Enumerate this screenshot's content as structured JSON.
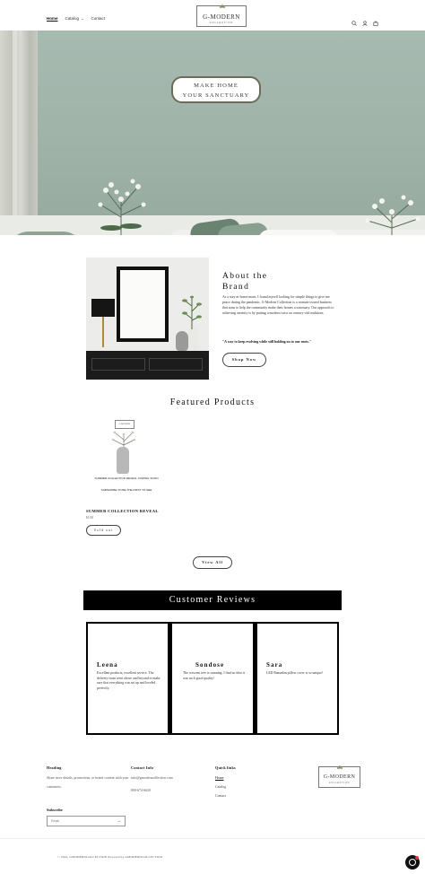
{
  "header": {
    "nav": [
      {
        "label": "Home",
        "active": true
      },
      {
        "label": "Catalog",
        "has_dropdown": true
      },
      {
        "label": "Contact"
      }
    ],
    "logo_name": "G-MODERN",
    "logo_sub": "COLLECTION",
    "icons": [
      "search-icon",
      "account-icon",
      "cart-icon"
    ]
  },
  "hero": {
    "line1": "MAKE HOME",
    "line2": "YOUR SANCTUARY"
  },
  "about": {
    "title_line1": "About the",
    "title_line2": "Brand",
    "body": "As a stay-at-home mom, I found myself looking for simple things to give me peace during the pandemic. G-Modern Collection is a woman-owned business that aims to help the community make their homes a sanctuary. Our approach to achieving serenity is by putting a modern twist on century-old traditions.",
    "quote": "\"A way to keep evolving while still holding on to our roots.\"",
    "button": "Shop Now"
  },
  "featured": {
    "title": "Featured Products",
    "products": [
      {
        "image_logo": "G-MODERN",
        "image_text1": "SUMMER COLLECTION REVEAL COMING SOON",
        "image_text2": "SUBSCRIBE TO BE THE FIRST TO SEE",
        "name": "SUMMER COLLECTION REVEAL",
        "price": "$1.00",
        "status": "Sold out"
      }
    ],
    "view_all": "View All"
  },
  "reviews": {
    "title": "Customer Reviews",
    "items": [
      {
        "name": "Leena",
        "text": "Excellent products, excellent service. The delivery team went above and beyond to make sure that everything was set up and leveled perfectly."
      },
      {
        "name": "Sondose",
        "text": "The crescent tree is stunning. I find no idea it was such good quality!"
      },
      {
        "name": "Sara",
        "text": "LED Ramadan pillow cover is so unique!"
      }
    ]
  },
  "footer": {
    "heading_col": {
      "title": "Heading",
      "text": "Share store details, promotions, or brand content with your customers."
    },
    "contact": {
      "title": "Contact Info",
      "email": "info@gmoderncollection.com",
      "phone": "800-674-6620"
    },
    "quick_links": {
      "title": "Quick links",
      "links": [
        "Home",
        "Catalog",
        "Contact"
      ]
    },
    "subscribe": {
      "title": "Subscribe",
      "placeholder": "Email",
      "arrow": "→"
    },
    "logo_name": "G-MODERN",
    "logo_sub": "COLLECTION",
    "copyright": "© 2022, GMODERNCOLLECTION Powered by GMODERNCOLLECTION"
  },
  "colors": {
    "hero_wall": "#a6bab1",
    "reviews_banner": "#000000",
    "pillow_green": "#6a8270"
  }
}
